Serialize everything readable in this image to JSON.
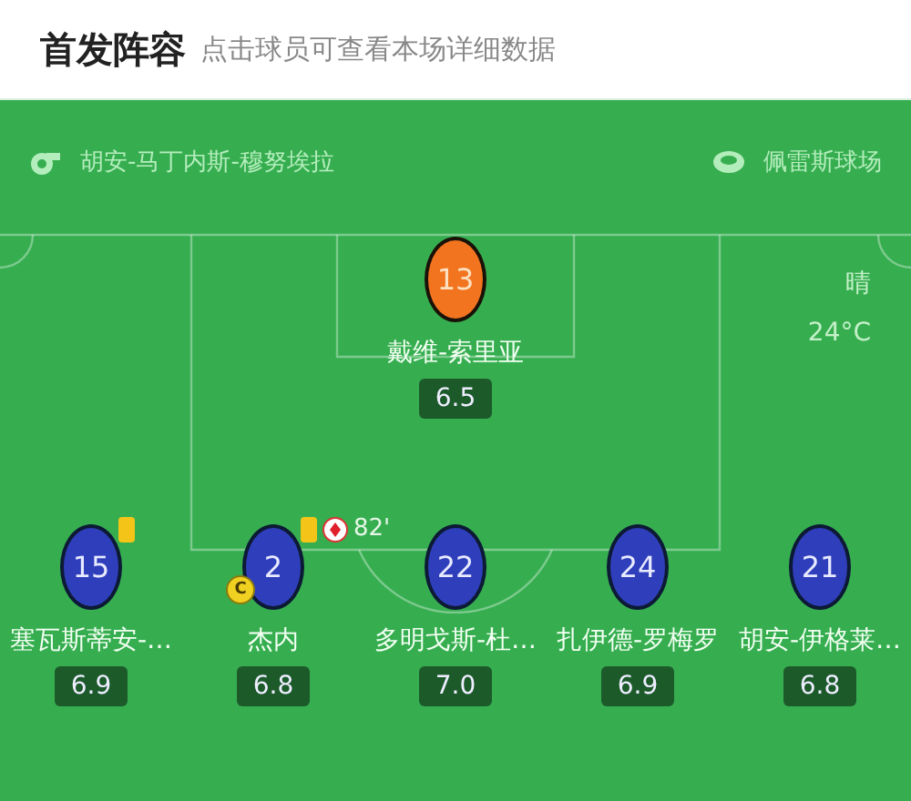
{
  "header": {
    "title": "首发阵容",
    "hint": "点击球员可查看本场详细数据"
  },
  "match_info": {
    "referee": "胡安-马丁内斯-穆努埃拉",
    "venue": "佩雷斯球场"
  },
  "weather": {
    "condition": "晴",
    "temperature": "24°C"
  },
  "lines": [
    {
      "players": [
        {
          "number": "13",
          "name": "戴维-索里亚",
          "rating": "6.5",
          "kind": "goalkeeper",
          "yellow_card": false
        }
      ]
    },
    {
      "players": [
        {
          "number": "15",
          "name": "塞瓦斯蒂安-…",
          "rating": "6.9",
          "kind": "outfield",
          "yellow_card": true
        },
        {
          "number": "2",
          "name": "杰内",
          "rating": "6.8",
          "kind": "outfield",
          "yellow_card": true,
          "captain_badge": "C",
          "sub_off_minute": "82'"
        },
        {
          "number": "22",
          "name": "多明戈斯-杜…",
          "rating": "7.0",
          "kind": "outfield",
          "yellow_card": false
        },
        {
          "number": "24",
          "name": "扎伊德-罗梅罗",
          "rating": "6.9",
          "kind": "outfield",
          "yellow_card": false
        },
        {
          "number": "21",
          "name": "胡安-伊格莱…",
          "rating": "6.8",
          "kind": "outfield",
          "yellow_card": false
        }
      ]
    }
  ]
}
